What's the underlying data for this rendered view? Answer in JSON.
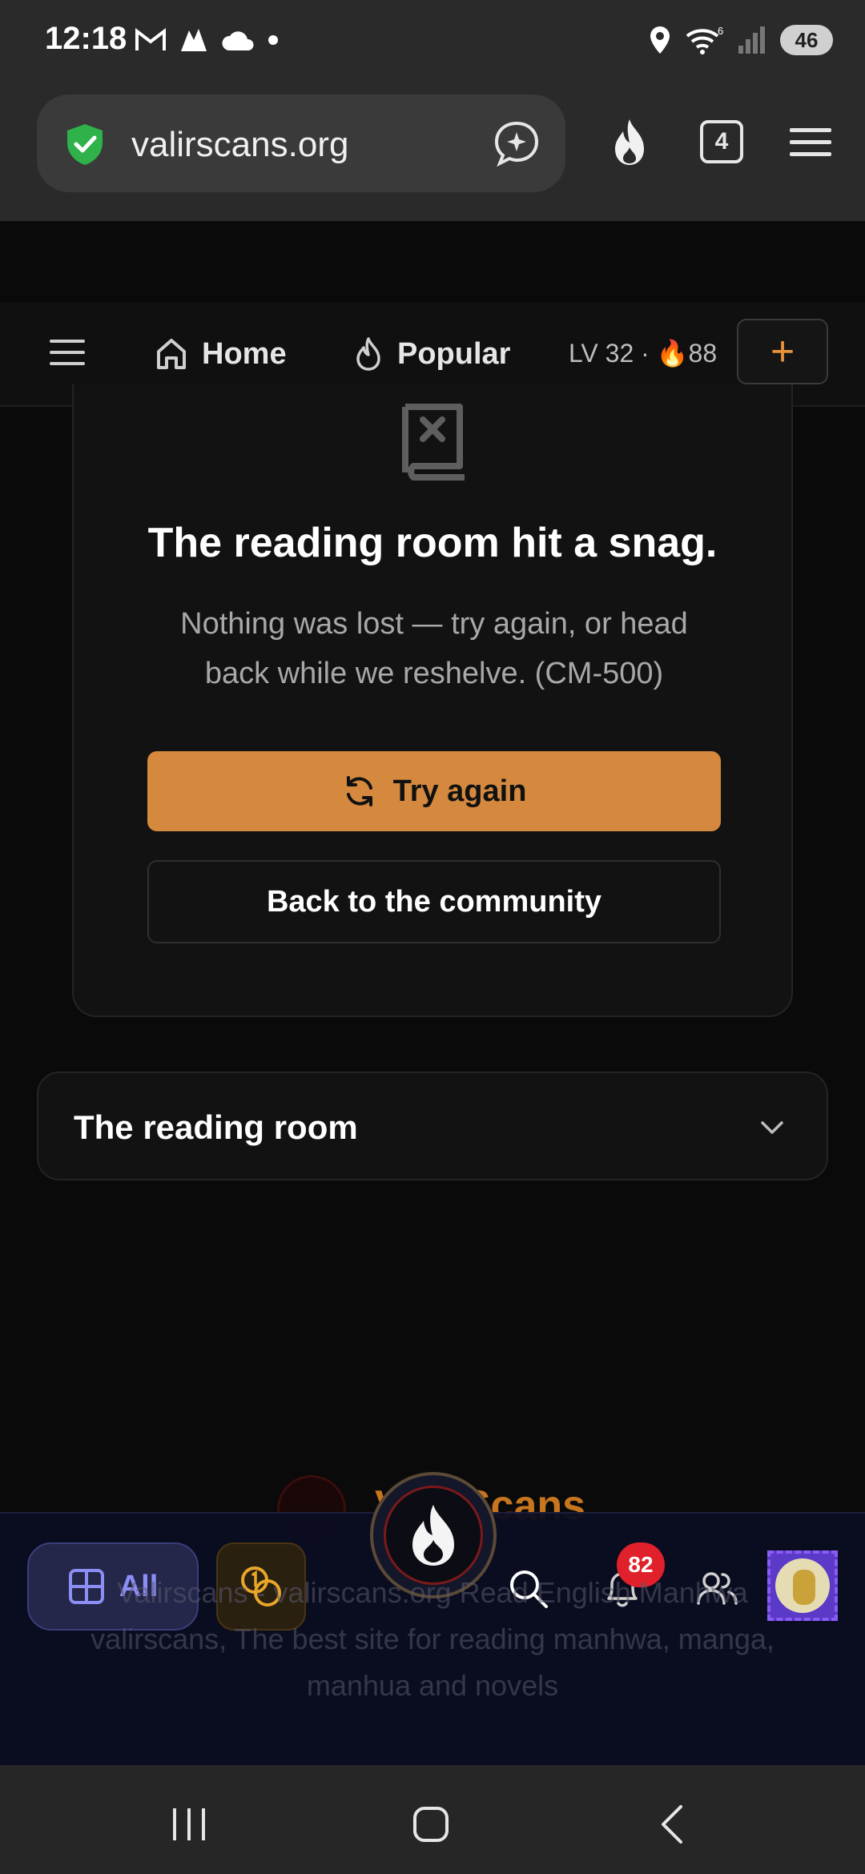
{
  "status_bar": {
    "time": "12:18",
    "battery": "46",
    "wifi_badge": "6",
    "icons_left": [
      "gmail-icon",
      "app-icon",
      "cloud-icon",
      "dot-icon"
    ],
    "icons_right": [
      "location-icon",
      "wifi-icon",
      "signal-icon",
      "battery-icon"
    ]
  },
  "browser": {
    "url": "valirscans.org",
    "tab_count": "4",
    "icons": [
      "shield-check-icon",
      "assistant-icon",
      "flame-icon",
      "tabs-icon",
      "menu-icon"
    ]
  },
  "header": {
    "home_label": "Home",
    "popular_label": "Popular",
    "level_text": "LV 32 · 🔥88",
    "plus_label": "+"
  },
  "error": {
    "title": "The reading room hit a snag.",
    "description": "Nothing was lost — try again, or head back while we reshelve. (CM-500)",
    "try_again_label": "Try again",
    "back_label": "Back to the community"
  },
  "accordion": {
    "title": "The reading room"
  },
  "footer": {
    "brand": "ValirScans",
    "text": "Valirscans - valirscans.org Read English Manhwa valirscans, The best site for reading manhwa, manga, manhua and novels"
  },
  "bottom_nav": {
    "all_label": "All",
    "notification_count": "82"
  },
  "colors": {
    "accent_orange": "#d4893e",
    "nav_bg": "#0a0c20",
    "badge_red": "#e0202a",
    "all_purple": "#8b8ff5"
  }
}
